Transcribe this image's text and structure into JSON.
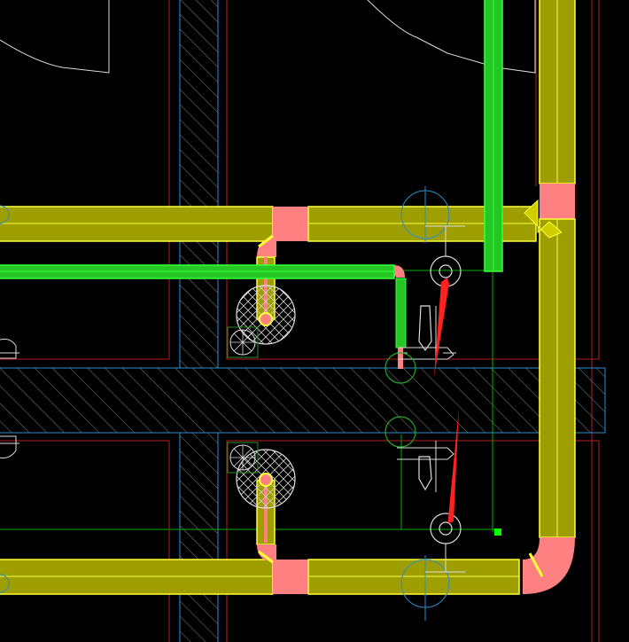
{
  "view": {
    "type": "CAD plumbing plan view",
    "background_color": "#000000"
  },
  "layers": {
    "yellow_pipe": {
      "fill": "#9E9E00",
      "stroke": "#FFFF3A"
    },
    "fitting": {
      "fill": "#FF8080"
    },
    "green_pipe": {
      "fill": "#24C724",
      "stroke": "#38FF38"
    },
    "green_line": {
      "stroke": "#00CC00"
    },
    "red_line": {
      "stroke": "#CC2020"
    },
    "cyan_line": {
      "stroke": "#2A8FCF"
    },
    "white_line": {
      "stroke": "#DDDDDD"
    },
    "hatch": {
      "stroke": "#7A7A7A"
    },
    "grip": {
      "fill": "#00FF00"
    },
    "leader": {
      "fill": "#FF2020"
    }
  },
  "icons": [
    "floor-drain-icon",
    "toilet-icon",
    "faucet-icon",
    "fixture-circle-icon",
    "grip-point-icon",
    "red-leader-arrow-icon"
  ]
}
